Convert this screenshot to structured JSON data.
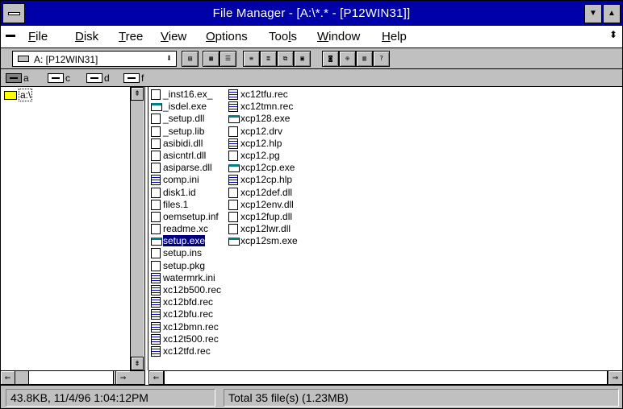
{
  "window": {
    "title": "File Manager - [A:\\*.* - [P12WIN31]]",
    "down_arrow": "▼",
    "up_arrow": "▲"
  },
  "menu": {
    "items": [
      {
        "label": "File",
        "underline": "F",
        "rest": "ile"
      },
      {
        "label": "Disk",
        "underline": "D",
        "rest": "isk"
      },
      {
        "label": "Tree",
        "underline": "T",
        "rest": "ree"
      },
      {
        "label": "View",
        "underline": "V",
        "rest": "iew"
      },
      {
        "label": "Options",
        "underline": "O",
        "rest": "ptions"
      },
      {
        "label": "Tools",
        "pre": "Too",
        "underline": "l",
        "rest": "s"
      },
      {
        "label": "Window",
        "underline": "W",
        "rest": "indow"
      },
      {
        "label": "Help",
        "underline": "H",
        "rest": "elp"
      }
    ],
    "restore_glyph": "⬍"
  },
  "toolbar": {
    "drive_selected": "A: [P12WIN31]",
    "drive_arrow": "⬇"
  },
  "drives": [
    {
      "letter": "a",
      "selected": true
    },
    {
      "letter": "c",
      "selected": false
    },
    {
      "letter": "d",
      "selected": false
    },
    {
      "letter": "f",
      "selected": false
    }
  ],
  "tree": {
    "root": "a:\\"
  },
  "files": {
    "column1": [
      {
        "name": "_inst16.ex_",
        "type": "file"
      },
      {
        "name": "_isdel.exe",
        "type": "exe"
      },
      {
        "name": "_setup.dll",
        "type": "file"
      },
      {
        "name": "_setup.lib",
        "type": "file"
      },
      {
        "name": "asibidi.dll",
        "type": "file"
      },
      {
        "name": "asicntrl.dll",
        "type": "file"
      },
      {
        "name": "asiparse.dll",
        "type": "file"
      },
      {
        "name": "comp.ini",
        "type": "doc"
      },
      {
        "name": "disk1.id",
        "type": "file"
      },
      {
        "name": "files.1",
        "type": "file"
      },
      {
        "name": "oemsetup.inf",
        "type": "file"
      },
      {
        "name": "readme.xc",
        "type": "file"
      },
      {
        "name": "setup.exe",
        "type": "exe",
        "selected": true
      },
      {
        "name": "setup.ins",
        "type": "file"
      },
      {
        "name": "setup.pkg",
        "type": "file"
      },
      {
        "name": "watermrk.ini",
        "type": "doc"
      },
      {
        "name": "xc12b500.rec",
        "type": "doc"
      },
      {
        "name": "xc12bfd.rec",
        "type": "doc"
      },
      {
        "name": "xc12bfu.rec",
        "type": "doc"
      },
      {
        "name": "xc12bmn.rec",
        "type": "doc"
      },
      {
        "name": "xc12t500.rec",
        "type": "doc"
      },
      {
        "name": "xc12tfd.rec",
        "type": "doc"
      }
    ],
    "column2": [
      {
        "name": "xc12tfu.rec",
        "type": "doc"
      },
      {
        "name": "xc12tmn.rec",
        "type": "doc"
      },
      {
        "name": "xcp128.exe",
        "type": "exe"
      },
      {
        "name": "xcp12.drv",
        "type": "file"
      },
      {
        "name": "xcp12.hlp",
        "type": "doc"
      },
      {
        "name": "xcp12.pg",
        "type": "file"
      },
      {
        "name": "xcp12cp.exe",
        "type": "exe"
      },
      {
        "name": "xcp12cp.hlp",
        "type": "doc"
      },
      {
        "name": "xcp12def.dll",
        "type": "file"
      },
      {
        "name": "xcp12env.dll",
        "type": "file"
      },
      {
        "name": "xcp12fup.dll",
        "type": "file"
      },
      {
        "name": "xcp12lwr.dll",
        "type": "file"
      },
      {
        "name": "xcp12sm.exe",
        "type": "exe"
      }
    ]
  },
  "status": {
    "left": "43.8KB, 11/4/96 1:04:12PM",
    "right": "Total 35 file(s) (1.23MB)"
  },
  "colors": {
    "title_bar": "#0000a8",
    "chrome": "#c0c0c0",
    "selection": "#000080"
  }
}
